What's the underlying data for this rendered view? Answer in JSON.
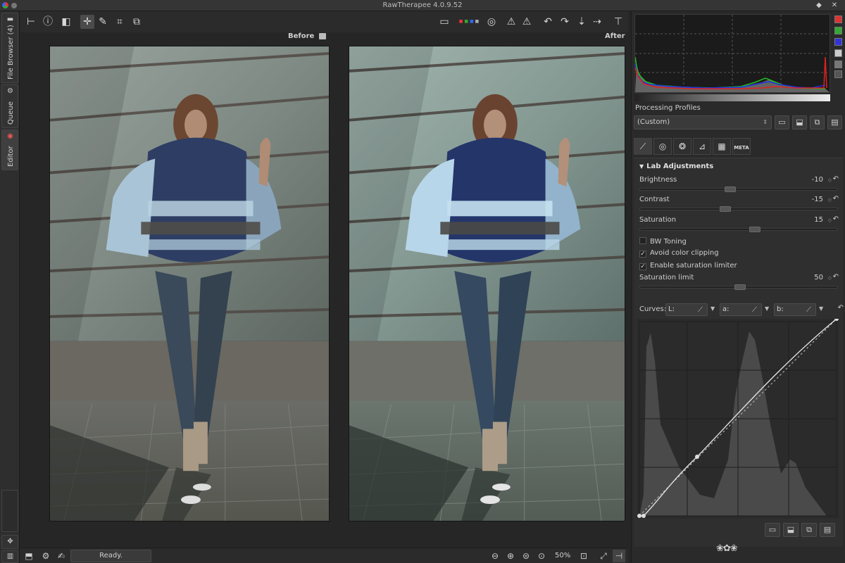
{
  "window": {
    "title": "RawTherapee 4.0.9.52",
    "controls": [
      "◆",
      "✕"
    ]
  },
  "side_tabs": [
    {
      "label": "File Browser (4)",
      "icon": "folder-icon"
    },
    {
      "label": "Queue",
      "icon": "gears-icon"
    },
    {
      "label": "Editor",
      "icon": "color-wheel-icon"
    }
  ],
  "panes": {
    "before_label": "Before",
    "after_label": "After"
  },
  "status": {
    "text": "Ready.",
    "zoom": "50%"
  },
  "histogram": {
    "channel_buttons": [
      "red",
      "green",
      "blue",
      "luminance",
      "raw",
      "bar"
    ],
    "colors": {
      "red": "#e02020",
      "green": "#20c020",
      "blue": "#2030e0"
    }
  },
  "profiles": {
    "label": "Processing Profiles",
    "selected": "(Custom)"
  },
  "tool_tabs": [
    "exposure",
    "detail",
    "color",
    "transform",
    "raw",
    "META"
  ],
  "lab": {
    "title": "Lab Adjustments",
    "sliders": [
      {
        "label": "Brightness",
        "value": "-10"
      },
      {
        "label": "Contrast",
        "value": "-15"
      },
      {
        "label": "Saturation",
        "value": "15"
      }
    ],
    "checkboxes": [
      {
        "label": "BW Toning",
        "checked": false
      },
      {
        "label": "Avoid color clipping",
        "checked": true
      },
      {
        "label": "Enable saturation limiter",
        "checked": true
      }
    ],
    "saturation_limit": {
      "label": "Saturation limit",
      "value": "50"
    },
    "curves": {
      "label": "Curves:",
      "channels": [
        "L:",
        "a:",
        "b:"
      ]
    }
  },
  "logo": "❀✿❀"
}
